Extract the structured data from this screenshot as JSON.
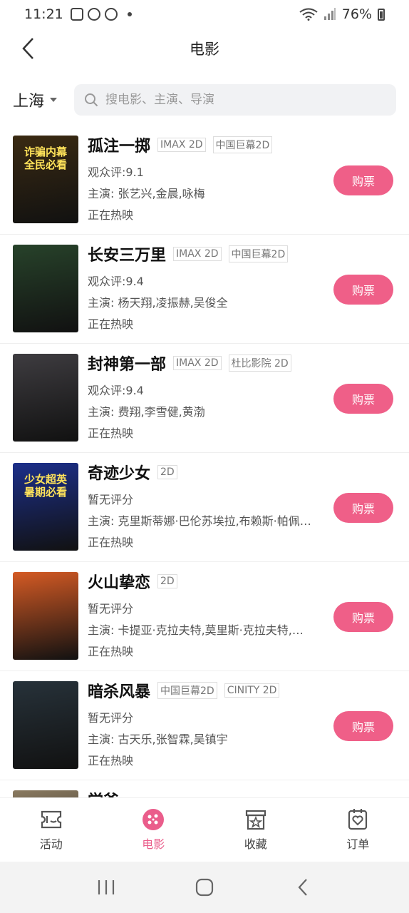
{
  "status_bar": {
    "time": "11:21",
    "battery": "76%"
  },
  "header": {
    "title": "电影"
  },
  "search": {
    "city": "上海",
    "placeholder": "搜电影、主演、导演"
  },
  "movies": [
    {
      "title": "孤注一掷",
      "tags": [
        "IMAX 2D",
        "中国巨幕2D"
      ],
      "rating": "观众评:9.1",
      "cast": "主演: 张艺兴,金晨,咏梅",
      "status": "正在热映",
      "buy_label": "购票",
      "poster_color": "#3a2a12",
      "poster_text": "诈骗内幕\n全民必看"
    },
    {
      "title": "长安三万里",
      "tags": [
        "IMAX 2D",
        "中国巨幕2D"
      ],
      "rating": "观众评:9.4",
      "cast": "主演: 杨天翔,凌振赫,吴俊全",
      "status": "正在热映",
      "buy_label": "购票",
      "poster_color": "#27422a",
      "poster_text": ""
    },
    {
      "title": "封神第一部",
      "tags": [
        "IMAX 2D",
        "杜比影院 2D"
      ],
      "rating": "观众评:9.4",
      "cast": "主演: 费翔,李雪健,黄渤",
      "status": "正在热映",
      "buy_label": "购票",
      "poster_color": "#3e3c40",
      "poster_text": ""
    },
    {
      "title": "奇迹少女",
      "tags": [
        "2D"
      ],
      "rating": "暂无评分",
      "cast": "主演: 克里斯蒂娜·巴伦苏埃拉,布赖斯·帕佩尼…",
      "status": "正在热映",
      "buy_label": "购票",
      "poster_color": "#1c2f8a",
      "poster_text": "少女超英\n暑期必看"
    },
    {
      "title": "火山挚恋",
      "tags": [
        "2D"
      ],
      "rating": "暂无评分",
      "cast": "主演: 卡提亚·克拉夫特,莫里斯·克拉夫特,…",
      "status": "正在热映",
      "buy_label": "购票",
      "poster_color": "#d45a24",
      "poster_text": ""
    },
    {
      "title": "暗杀风暴",
      "tags": [
        "中国巨幕2D",
        "CINITY 2D"
      ],
      "rating": "暂无评分",
      "cast": "主演: 古天乐,张智霖,吴镇宇",
      "status": "正在热映",
      "buy_label": "购票",
      "poster_color": "#27323a",
      "poster_text": ""
    },
    {
      "title": "学爸",
      "tags": [
        "",
        ""
      ],
      "rating": "",
      "cast": "",
      "status": "",
      "buy_label": "",
      "poster_color": "#8a7a60",
      "poster_text": ""
    }
  ],
  "tabs": [
    {
      "label": "活动",
      "icon": "ticket-icon"
    },
    {
      "label": "电影",
      "icon": "movie-icon"
    },
    {
      "label": "收藏",
      "icon": "favorite-box-icon"
    },
    {
      "label": "订单",
      "icon": "order-icon"
    }
  ],
  "colors": {
    "accent": "#ef5f88",
    "active_tab": "#ea5d8b"
  }
}
